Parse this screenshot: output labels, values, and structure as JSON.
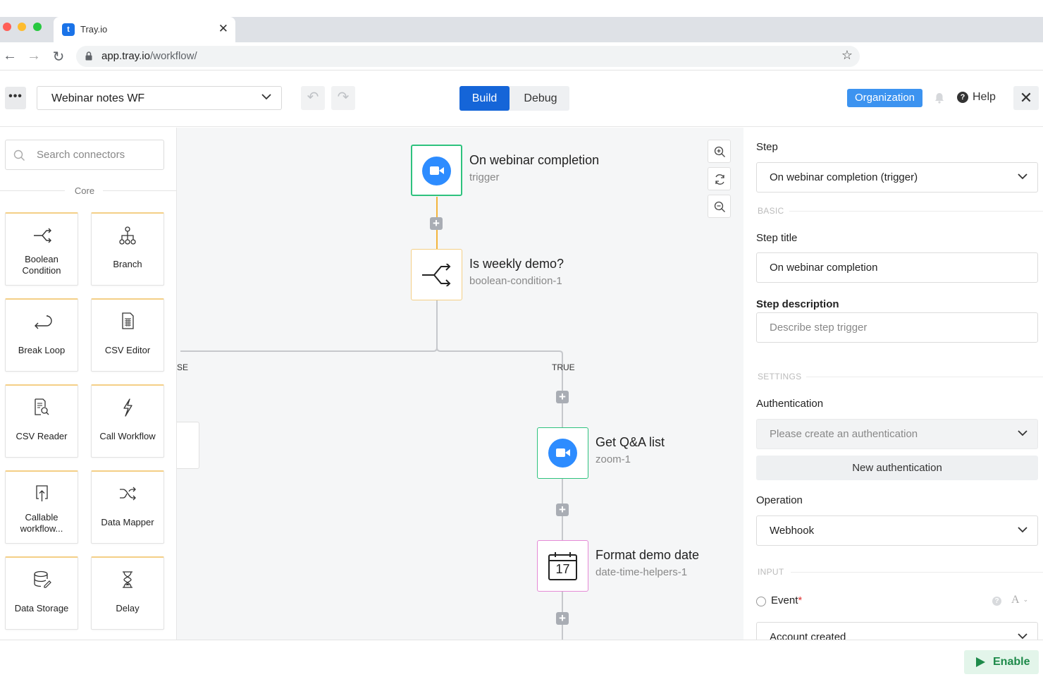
{
  "browser": {
    "tab_title": "Tray.io",
    "favicon": "tray-logo-icon",
    "url_host": "app.tray.io",
    "url_path": "/workflow/"
  },
  "header": {
    "workflow_name": "Webinar notes WF",
    "build_label": "Build",
    "debug_label": "Debug",
    "organization_label": "Organization",
    "help_label": "Help",
    "accent_color": "#1565d8",
    "org_color": "#3c93f0"
  },
  "sidebar": {
    "search_placeholder": "Search connectors",
    "section_label": "Core",
    "connectors": [
      {
        "label": "Boolean Condition",
        "icon": "boolean-branch-icon"
      },
      {
        "label": "Branch",
        "icon": "branch-tree-icon"
      },
      {
        "label": "Break Loop",
        "icon": "break-loop-icon"
      },
      {
        "label": "CSV Editor",
        "icon": "csv-document-icon"
      },
      {
        "label": "CSV Reader",
        "icon": "csv-search-icon"
      },
      {
        "label": "Call Workflow",
        "icon": "lightning-icon"
      },
      {
        "label": "Callable workflow...",
        "icon": "callable-upload-icon"
      },
      {
        "label": "Data Mapper",
        "icon": "shuffle-icon"
      },
      {
        "label": "Data Storage",
        "icon": "database-icon"
      },
      {
        "label": "Delay",
        "icon": "hourglass-icon"
      }
    ]
  },
  "canvas": {
    "nodes": [
      {
        "title": "On webinar completion",
        "subtitle": "trigger",
        "icon": "zoom-camera-icon"
      },
      {
        "title": "Is weekly demo?",
        "subtitle": "boolean-condition-1",
        "icon": "boolean-branch-icon"
      },
      {
        "title": "Get Q&A list",
        "subtitle": "zoom-1",
        "icon": "zoom-camera-icon"
      },
      {
        "title": "Format demo date",
        "subtitle": "date-time-helpers-1",
        "icon": "calendar-icon",
        "calendar_day": "17"
      }
    ],
    "false_label": "SE",
    "true_label": "TRUE"
  },
  "panel": {
    "step_label": "Step",
    "step_value": "On webinar completion (trigger)",
    "basic_section": "BASIC",
    "step_title_label": "Step title",
    "step_title_value": "On webinar completion",
    "step_desc_label": "Step description",
    "step_desc_placeholder": "Describe step trigger",
    "settings_section": "SETTINGS",
    "auth_label": "Authentication",
    "auth_placeholder": "Please create an authentication",
    "new_auth_label": "New authentication",
    "operation_label": "Operation",
    "operation_value": "Webhook",
    "input_section": "INPUT",
    "event_label": "Event",
    "event_required_mark": "*",
    "event_type_glyph": "A",
    "event_value": "Account created"
  },
  "footer": {
    "enable_label": "Enable",
    "enable_color": "#1e8a4a"
  }
}
